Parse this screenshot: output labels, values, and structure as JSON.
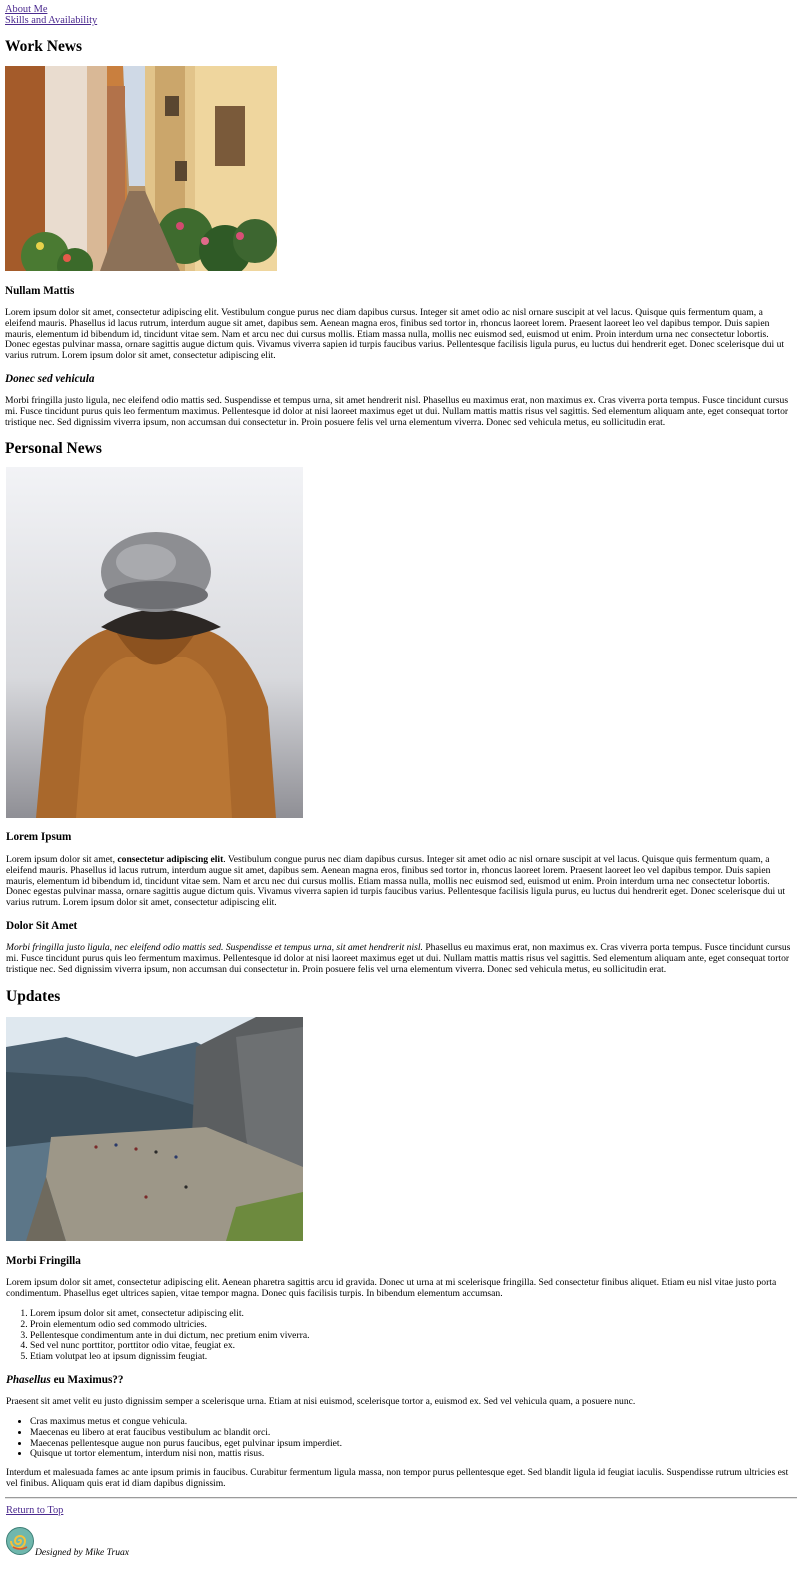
{
  "nav": {
    "about": "About Me",
    "skills": "Skills and Availability"
  },
  "work": {
    "heading": "Work News",
    "article1_title": "Nullam Mattis",
    "article1_body": "Lorem ipsum dolor sit amet, consectetur adipiscing elit. Vestibulum congue purus nec diam dapibus cursus. Integer sit amet odio ac nisl ornare suscipit at vel lacus. Quisque quis fermentum quam, a eleifend mauris. Phasellus id lacus rutrum, interdum augue sit amet, dapibus sem. Aenean magna eros, finibus sed tortor in, rhoncus laoreet lorem. Praesent laoreet leo vel dapibus tempor. Duis sapien mauris, elementum id bibendum id, tincidunt vitae sem. Nam et arcu nec dui cursus mollis. Etiam massa nulla, mollis nec euismod sed, euismod ut enim. Proin interdum urna nec consectetur lobortis. Donec egestas pulvinar massa, ornare sagittis augue dictum quis. Vivamus viverra sapien id turpis faucibus varius. Pellentesque facilisis ligula purus, eu luctus dui hendrerit eget. Donec scelerisque dui ut varius rutrum. Lorem ipsum dolor sit amet, consectetur adipiscing elit.",
    "article2_title": "Donec sed vehicula",
    "article2_body": "Morbi fringilla justo ligula, nec eleifend odio mattis sed. Suspendisse et tempus urna, sit amet hendrerit nisl. Phasellus eu maximus erat, non maximus ex. Cras viverra porta tempus. Fusce tincidunt cursus mi. Fusce tincidunt purus quis leo fermentum maximus. Pellentesque id dolor at nisi laoreet maximus eget ut dui. Nullam mattis mattis risus vel sagittis. Sed elementum aliquam ante, eget consequat tortor tristique nec. Sed dignissim viverra ipsum, non accumsan dui consectetur in. Proin posuere felis vel urna elementum viverra. Donec sed vehicula metus, eu sollicitudin erat."
  },
  "personal": {
    "heading": "Personal News",
    "article1_title": "Lorem Ipsum",
    "article1_body_a": "Lorem ipsum dolor sit amet, ",
    "article1_body_bold": "consectetur adipiscing elit",
    "article1_body_b": ". Vestibulum congue purus nec diam dapibus cursus. Integer sit amet odio ac nisl ornare suscipit at vel lacus. Quisque quis fermentum quam, a eleifend mauris. Phasellus id lacus rutrum, interdum augue sit amet, dapibus sem. Aenean magna eros, finibus sed tortor in, rhoncus laoreet lorem. Praesent laoreet leo vel dapibus tempor. Duis sapien mauris, elementum id bibendum id, tincidunt vitae sem. Nam et arcu nec dui cursus mollis. Etiam massa nulla, mollis nec euismod sed, euismod ut enim. Proin interdum urna nec consectetur lobortis. Donec egestas pulvinar massa, ornare sagittis augue dictum quis. Vivamus viverra sapien id turpis faucibus varius. Pellentesque facilisis ligula purus, eu luctus dui hendrerit eget. Donec scelerisque dui ut varius rutrum. Lorem ipsum dolor sit amet, consectetur adipiscing elit.",
    "article2_title": "Dolor Sit Amet",
    "article2_body_italic": "Morbi fringilla justo ligula, nec eleifend odio mattis sed. Suspendisse et tempus urna, sit amet hendrerit nisl.",
    "article2_body_rest": " Phasellus eu maximus erat, non maximus ex. Cras viverra porta tempus. Fusce tincidunt cursus mi. Fusce tincidunt purus quis leo fermentum maximus. Pellentesque id dolor at nisi laoreet maximus eget ut dui. Nullam mattis mattis risus vel sagittis. Sed elementum aliquam ante, eget consequat tortor tristique nec. Sed dignissim viverra ipsum, non accumsan dui consectetur in. Proin posuere felis vel urna elementum viverra. Donec sed vehicula metus, eu sollicitudin erat."
  },
  "updates": {
    "heading": "Updates",
    "article1_title": "Morbi Fringilla",
    "article1_body": "Lorem ipsum dolor sit amet, consectetur adipiscing elit. Aenean pharetra sagittis arcu id gravida. Donec ut urna at mi scelerisque fringilla. Sed consectetur finibus aliquet. Etiam eu nisl vitae justo porta condimentum. Phasellus eget ultrices sapien, vitae tempor magna. Donec quis facilisis turpis. In bibendum elementum accumsan.",
    "ordered_list": [
      "Lorem ipsum dolor sit amet, consectetur adipiscing elit.",
      "Proin elementum odio sed commodo ultricies.",
      "Pellentesque condimentum ante in dui dictum, nec pretium enim viverra.",
      "Sed vel nunc porttitor, porttitor odio vitae, feugiat ex.",
      "Etiam volutpat leo at ipsum dignissim feugiat."
    ],
    "article2_title_italic": "Phasellus",
    "article2_title_rest": " eu Maximus??",
    "article2_body": "Praesent sit amet velit eu justo dignissim semper a scelerisque urna. Etiam at nisi euismod, scelerisque tortor a, euismod ex. Sed vel vehicula quam, a posuere nunc.",
    "unordered_list": [
      "Cras maximus metus et congue vehicula.",
      "Maecenas eu libero at erat faucibus vestibulum ac blandit orci.",
      "Maecenas pellentesque augue non purus faucibus, eget pulvinar ipsum imperdiet.",
      "Quisque ut tortor elementum, interdum nisi non, mattis risus."
    ],
    "closing_body": "Interdum et malesuada fames ac ante ipsum primis in faucibus. Curabitur fermentum ligula massa, non tempor purus pellentesque eget. Sed blandit ligula id feugiat iaculis. Suspendisse rutrum ultricies est vel finibus. Aliquam quis erat id diam dapibus dignissim."
  },
  "footer": {
    "return_link": "Return to Top",
    "signature": "Designed by Mike Truax",
    "logo_icon": "spiral-logo-icon"
  },
  "colors": {
    "link": "#4b2a8f",
    "logo_bg": "#6fb7ad"
  }
}
